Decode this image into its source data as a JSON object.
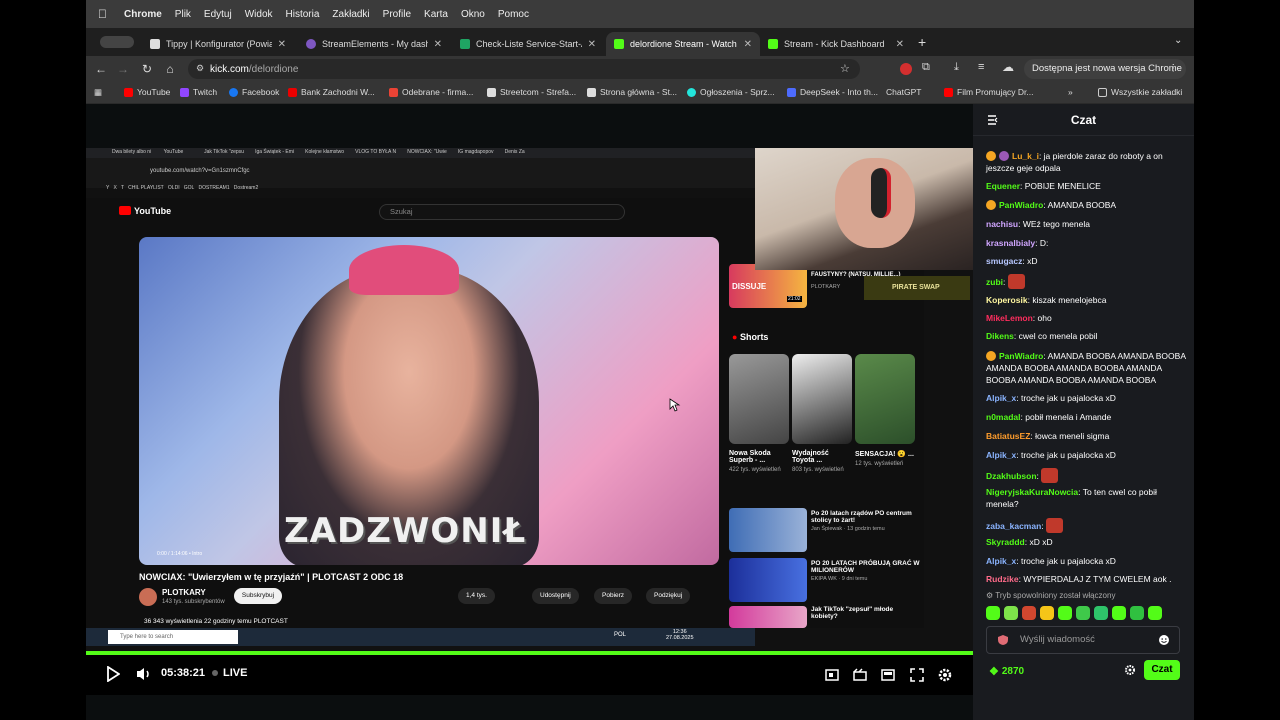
{
  "menubar": {
    "app": "Chrome",
    "items": [
      "Plik",
      "Edytuj",
      "Widok",
      "Historia",
      "Zakładki",
      "Profile",
      "Karta",
      "Okno",
      "Pomoc"
    ]
  },
  "tabs": [
    {
      "label": "Tippy | Konfigurator (Powiad",
      "color": "#2b2b2b"
    },
    {
      "label": "StreamElements - My dashbo",
      "color": "#7e57c2"
    },
    {
      "label": "Check-Liste Service-Start-Al",
      "color": "#1fa463"
    },
    {
      "label": "delordione Stream - Watch Li",
      "color": "#53fc18"
    },
    {
      "label": "Stream - Kick Dashboard",
      "color": "#53fc18"
    }
  ],
  "address": {
    "host": "kick.com",
    "path": "/delordione"
  },
  "update_label": "Dostępna jest nowa wersja Chrome",
  "bookmarks": [
    {
      "label": "YouTube",
      "color": "#ff0000"
    },
    {
      "label": "Twitch",
      "color": "#9146ff"
    },
    {
      "label": "Facebook",
      "color": "#1877f2"
    },
    {
      "label": "Bank Zachodni W...",
      "color": "#ec0000"
    },
    {
      "label": "Odebrane - firma...",
      "color": "#ea4335"
    },
    {
      "label": "Streetcom - Strefa...",
      "color": "#dddddd"
    },
    {
      "label": "Strona główna - St...",
      "color": "#dddddd"
    },
    {
      "label": "Ogłoszenia - Sprz...",
      "color": "#23e5db"
    },
    {
      "label": "DeepSeek - Into th...",
      "color": "#4d6bfe"
    },
    {
      "label": "ChatGPT",
      "color": "#353535"
    },
    {
      "label": "Film Promujący Dr...",
      "color": "#ff0000"
    }
  ],
  "all_bookmarks": "Wszystkie zakładki",
  "inner": {
    "tabs": [
      "Dwa bilety albo ni",
      "YouTube",
      "Jak TikTok \"zepsu",
      "Iga Świątek - Emi",
      "Kolejne kłamstwo",
      "VLOG TO BYŁA N",
      "NOWCIAX: \"Uwie",
      "IG magdapopov",
      "Denis Za"
    ],
    "url": "youtube.com/watch?v=Gn1szmnCfgc",
    "bookmarks": [
      "Y",
      "X",
      "T",
      "CHIL PLAYLIST",
      "OLDI",
      "GOL",
      "DOSTREAM1",
      "Dostream2"
    ],
    "search_placeholder": "Szukaj",
    "yt_logo": "YouTube",
    "overlay_text": "ZADZWONIŁ",
    "video_title": "NOWCIAX: \"Uwierzyłem w tę przyjaźń\" | PLOTCAST 2 ODC 18",
    "channel": "PLOTKARY",
    "subs": "143 tys. subskrybentów",
    "subscribe": "Subskrybuj",
    "likes": "1,4 tys.",
    "share": "Udostępnij",
    "download": "Pobierz",
    "thanks": "Podziękuj",
    "views": "36 343 wyświetlenia  22 godziny temu  PLOTCAST",
    "time_inner": "0:00 / 1:14:06 • Intro",
    "shorts": "Shorts",
    "short_items": [
      {
        "title": "Nowa Skoda Superb - ...",
        "views": "422 tys. wyświetleń"
      },
      {
        "title": "Wydajność Toyota ...",
        "views": "803 tys. wyświetleń"
      },
      {
        "title": "SENSACJA! 😮 ...",
        "views": "12 tys. wyświetleń"
      }
    ],
    "side_videos": [
      {
        "title": "Po 20 latach rządów PO centrum stolicy to żart!",
        "meta": "Jan Śpiewak · 13 godzin temu"
      },
      {
        "title": "PO 20 LATACH PRÓBUJĄ GRAĆ W MILIONERÓW",
        "meta": "EKIPA WK · 9 dni temu"
      },
      {
        "title": "Jak TikTok \"zepsuł\" młode kobiety?",
        "meta": ""
      }
    ],
    "top_side": {
      "title": "FAUSTYNY? (NATSU, MILLIE...)",
      "channel": "PLOTKARY",
      "label": "DISSUJE",
      "duration": "21:02",
      "pirate": "PIRATE SWAP"
    },
    "win_search": "Type here to search",
    "win_lang": "POL",
    "win_time": "12:36",
    "win_date": "27.08.2025"
  },
  "player": {
    "time": "05:38:21",
    "live": "LIVE"
  },
  "chat": {
    "title": "Czat",
    "messages": [
      {
        "user": "Lu_k_i",
        "color": "#f5a623",
        "text": "ja pierdole zaraz do roboty a on jeszcze geje odpala",
        "badges": 2
      },
      {
        "user": "Equener",
        "color": "#53fc18",
        "text": "POBIJE MENELICE"
      },
      {
        "user": "PanWiadro",
        "color": "#53fc18",
        "text": "AMANDA BOOBA",
        "badges": 1
      },
      {
        "user": "nachisu",
        "color": "#d0a6ff",
        "text": "WEź tego menela"
      },
      {
        "user": "krasnalbialy",
        "color": "#d0a6ff",
        "text": "D:"
      },
      {
        "user": "smugacz",
        "color": "#b7c7ff",
        "text": "xD"
      },
      {
        "user": "zubi",
        "color": "#53fc18",
        "text": "",
        "emote": true
      },
      {
        "user": "Koperosik",
        "color": "#fff7a0",
        "text": "kiszak menelojebca"
      },
      {
        "user": "MikeLemon",
        "color": "#ff2d5e",
        "text": "oho"
      },
      {
        "user": "Dikens",
        "color": "#53fc18",
        "text": "cwel co menela pobil"
      },
      {
        "user": "PanWiadro",
        "color": "#53fc18",
        "text": "AMANDA BOOBA AMANDA BOOBA AMANDA BOOBA AMANDA BOOBA AMANDA BOOBA AMANDA BOOBA AMANDA BOOBA",
        "badges": 1
      },
      {
        "user": "Alpik_x",
        "color": "#8ab4ff",
        "text": "troche jak u pajalocka xD"
      },
      {
        "user": "n0madal",
        "color": "#53fc18",
        "text": "pobił menela i Amande"
      },
      {
        "user": "BatiatusEZ",
        "color": "#ff9d2d",
        "text": "łowca meneli sigma"
      },
      {
        "user": "Alpik_x",
        "color": "#8ab4ff",
        "text": "troche jak u pajalocka xD"
      },
      {
        "user": "Dzakhubson",
        "color": "#53fc18",
        "text": "",
        "emote": true
      },
      {
        "user": "NigeryjskaKuraNowcia",
        "color": "#53fc18",
        "text": "To ten cwel co pobił menela?"
      },
      {
        "user": "zaba_kacman",
        "color": "#8ab4ff",
        "text": "",
        "emote": true
      },
      {
        "user": "Skyraddd",
        "color": "#53fc18",
        "text": "xD xD"
      },
      {
        "user": "Alpik_x",
        "color": "#8ab4ff",
        "text": "troche jak u pajalocka xD"
      },
      {
        "user": "Rudzike",
        "color": "#ff6b8a",
        "text": "WYPIERDALAJ Z TYM CWELEM aok ."
      }
    ],
    "slowmode": "Tryb spowolniony został włączony",
    "placeholder": "Wyślij wiadomość",
    "points": "2870",
    "send": "Czat"
  },
  "colors": {
    "kick_green": "#53fc18",
    "chat_bg": "#191b1f"
  }
}
